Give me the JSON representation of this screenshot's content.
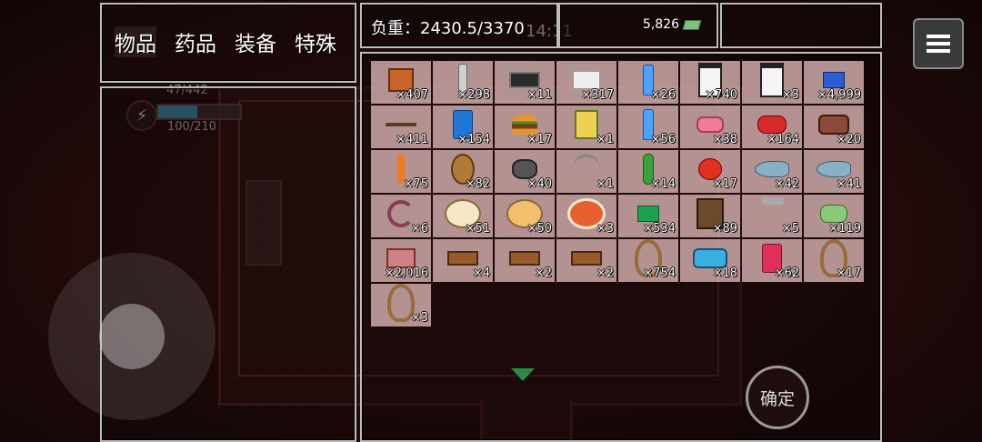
{
  "tabs": [
    {
      "label": "物品",
      "active": true
    },
    {
      "label": "药品",
      "active": false
    },
    {
      "label": "装备",
      "active": false
    },
    {
      "label": "特殊",
      "active": false
    }
  ],
  "weight": {
    "label": "负重：",
    "value": "2430.5/3370"
  },
  "money": {
    "amount": "5,826",
    "icon": "cash-icon"
  },
  "clock": "14:11",
  "hud": {
    "hp": "47/442",
    "energy": "100/210",
    "energy_fraction": 0.48
  },
  "confirm_label": "确定",
  "inventory": [
    {
      "icon": "i-box",
      "count": "×407"
    },
    {
      "icon": "i-nail",
      "count": "×298"
    },
    {
      "icon": "i-bar",
      "count": "×11"
    },
    {
      "icon": "i-paper",
      "count": "×317"
    },
    {
      "icon": "i-bottle",
      "count": "×26"
    },
    {
      "icon": "i-jar",
      "count": "×740"
    },
    {
      "icon": "i-jar",
      "count": "×3"
    },
    {
      "icon": "i-book",
      "count": "×4,999"
    },
    {
      "icon": "i-arrow",
      "count": "×411"
    },
    {
      "icon": "i-can",
      "count": "×154"
    },
    {
      "icon": "i-burger",
      "count": "×17"
    },
    {
      "icon": "i-tin",
      "count": "×1"
    },
    {
      "icon": "i-bottle",
      "count": "×56"
    },
    {
      "icon": "i-meat",
      "count": "×38"
    },
    {
      "icon": "i-berry",
      "count": "×164"
    },
    {
      "icon": "i-steak",
      "count": "×20"
    },
    {
      "icon": "i-carrot",
      "count": "×75"
    },
    {
      "icon": "i-potato",
      "count": "×82"
    },
    {
      "icon": "i-ore",
      "count": "×40"
    },
    {
      "icon": "i-pick",
      "count": "×1"
    },
    {
      "icon": "i-cuke",
      "count": "×14"
    },
    {
      "icon": "i-tomato",
      "count": "×17"
    },
    {
      "icon": "i-fish",
      "count": "×42"
    },
    {
      "icon": "i-fish",
      "count": "×41"
    },
    {
      "icon": "i-worm",
      "count": "×6"
    },
    {
      "icon": "i-dish",
      "count": "×51"
    },
    {
      "icon": "i-dish2",
      "count": "×50"
    },
    {
      "icon": "i-dish3",
      "count": "×3"
    },
    {
      "icon": "i-tape",
      "count": "×534"
    },
    {
      "icon": "i-bag",
      "count": "×89"
    },
    {
      "icon": "i-hammer",
      "count": "×5"
    },
    {
      "icon": "i-pebble",
      "count": "×119"
    },
    {
      "icon": "i-slab",
      "count": "×2,016"
    },
    {
      "icon": "i-wood",
      "count": "×4"
    },
    {
      "icon": "i-wood",
      "count": "×2"
    },
    {
      "icon": "i-wood",
      "count": "×2"
    },
    {
      "icon": "i-rope",
      "count": "×754"
    },
    {
      "icon": "i-tuna",
      "count": "×18"
    },
    {
      "icon": "i-soda",
      "count": "×62"
    },
    {
      "icon": "i-rope",
      "count": "×17"
    },
    {
      "icon": "i-rope",
      "count": "×3"
    }
  ]
}
